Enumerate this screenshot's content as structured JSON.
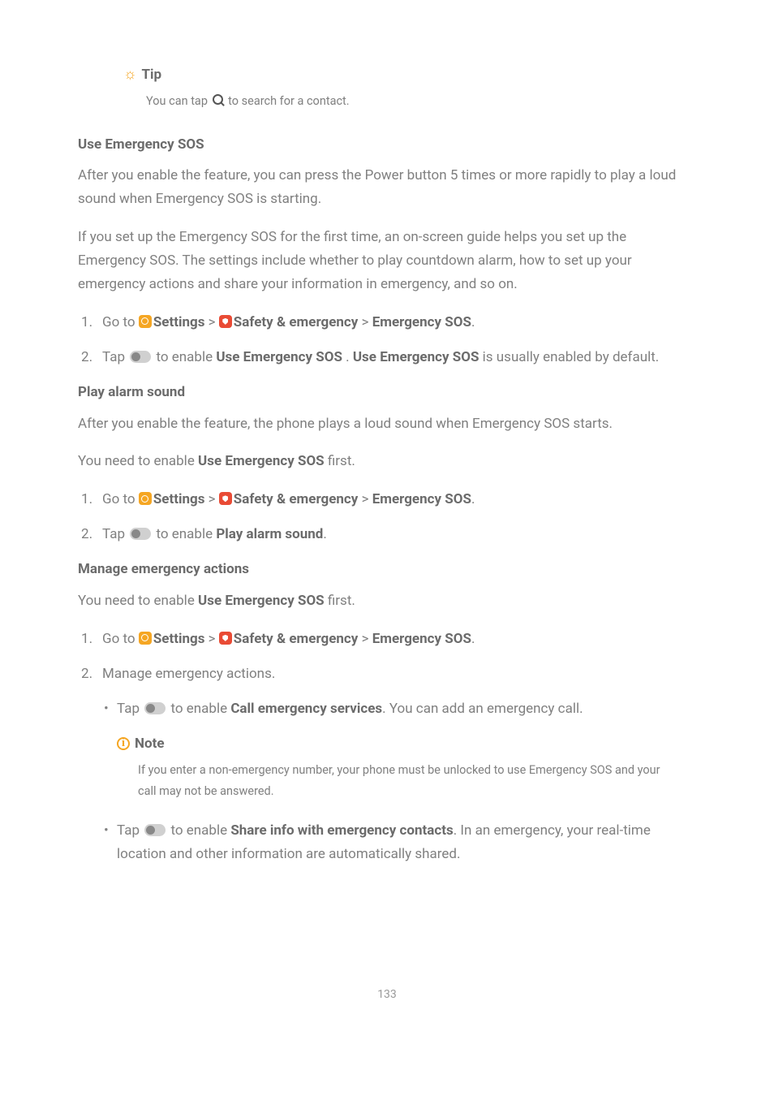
{
  "callout": {
    "tip_label": "Tip",
    "tip_body_pre": "You can tap ",
    "tip_body_post": " to search for a contact.",
    "note_label": "Note",
    "note_body": "If you enter a non-emergency number, your phone must be unlocked to use Emergency SOS and your call may not be answered."
  },
  "sections": {
    "use_sos": {
      "heading": "Use Emergency SOS",
      "p1": "After you enable the feature, you can press the Power button 5 times or more rapidly to play a loud sound when Emergency SOS is starting.",
      "p2": "If you set up the Emergency SOS for the first time, an on-screen guide helps you set up the Emergency SOS. The settings include whether to play countdown alarm, how to set up your emergency actions and share your information in emergency, and so on.",
      "step1_pre": "Go to ",
      "step2_pre": "Tap ",
      "step2_mid": " to enable ",
      "step2_bold1": "Use Emergency SOS",
      "step2_sep": " . ",
      "step2_bold2": "Use Emergency SOS",
      "step2_post": " is usually enabled by default."
    },
    "play_alarm": {
      "heading": "Play alarm sound",
      "p1": "After you enable the feature, the phone plays a loud sound when Emergency SOS starts.",
      "p2_pre": "You need to enable ",
      "p2_bold": "Use Emergency SOS",
      "p2_post": " first.",
      "step1_pre": "Go to ",
      "step2_pre": "Tap ",
      "step2_mid": " to enable ",
      "step2_bold": "Play alarm sound",
      "step2_post": "."
    },
    "manage": {
      "heading": "Manage emergency actions",
      "p1_pre": "You need to enable ",
      "p1_bold": "Use Emergency SOS",
      "p1_post": " first.",
      "step1_pre": "Go to ",
      "step2": "Manage emergency actions.",
      "b1_pre": "Tap ",
      "b1_mid": " to enable ",
      "b1_bold": "Call emergency services",
      "b1_post": ". You can add an emergency call.",
      "b2_pre": "Tap ",
      "b2_mid": " to enable ",
      "b2_bold": "Share info with emergency contacts",
      "b2_post": ". In an emergency, your real-time location and other information are automatically shared."
    }
  },
  "nav": {
    "settings": "Settings",
    "safety": "Safety & emergency",
    "sos": "Emergency SOS",
    "sep": " > "
  },
  "page_number": "133"
}
